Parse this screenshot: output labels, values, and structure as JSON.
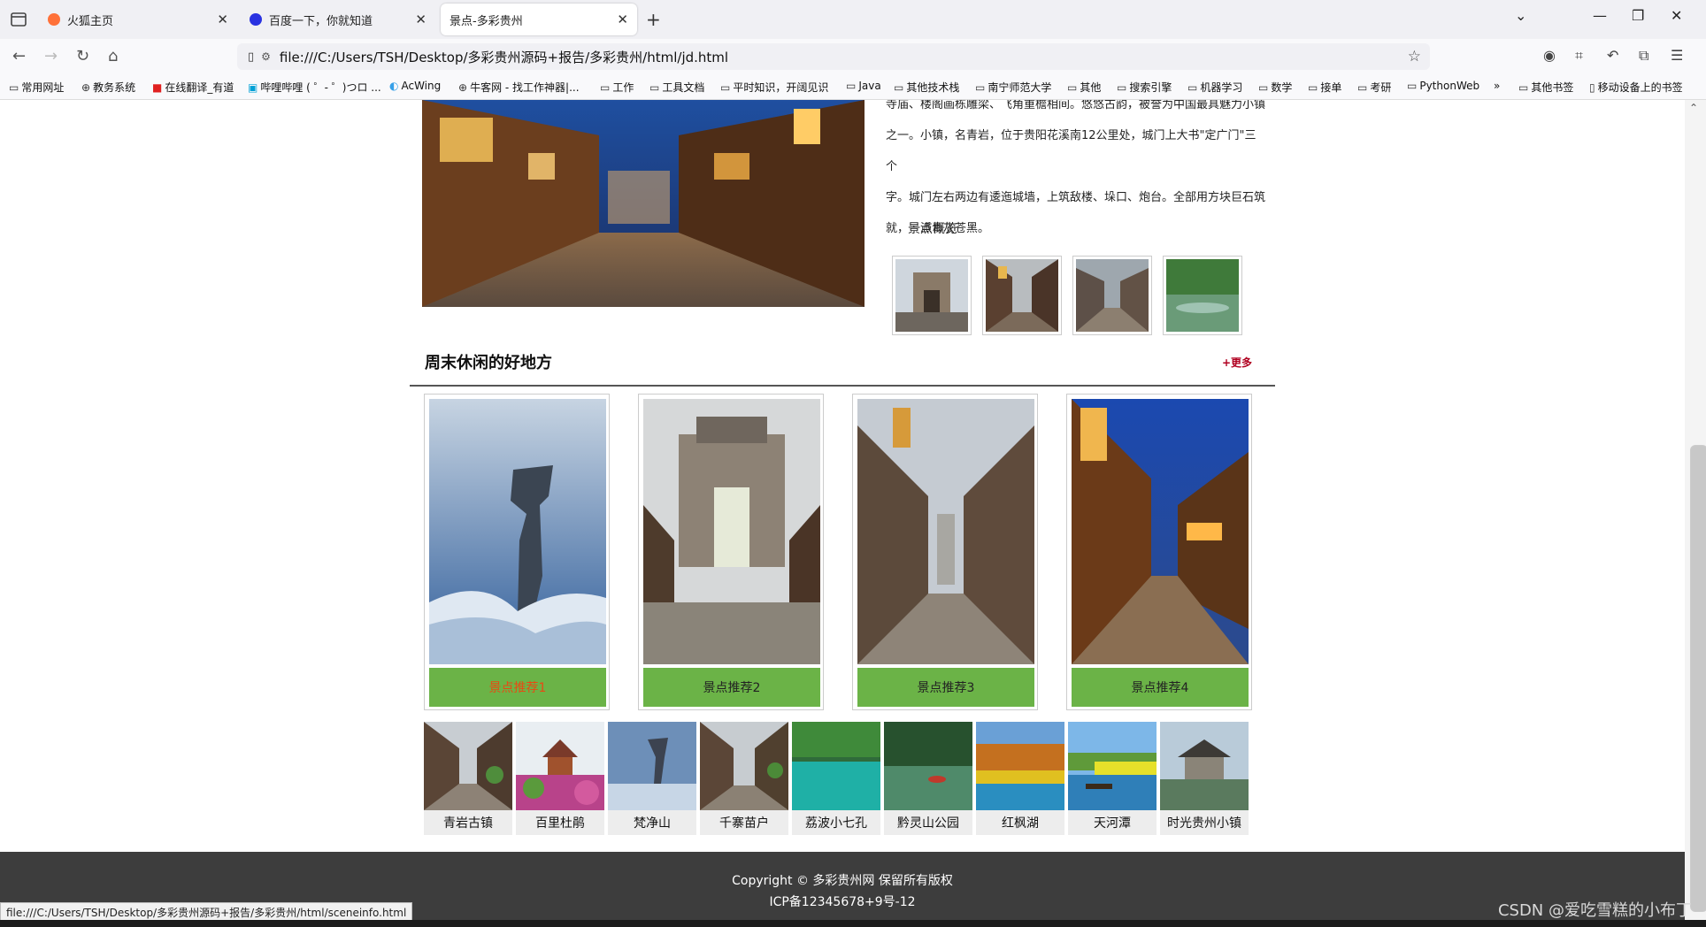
{
  "browser": {
    "tabs": [
      {
        "title": "火狐主页",
        "color": "#ff7139"
      },
      {
        "title": "百度一下，你就知道",
        "color": "#2932e1"
      },
      {
        "title": "景点-多彩贵州",
        "color": ""
      }
    ],
    "url": "file:///C:/Users/TSH/Desktop/多彩贵州源码+报告/多彩贵州/html/jd.html",
    "bookmarks": [
      "常用网址",
      "教务系统",
      "在线翻译_有道",
      "哔哩哔哩 ( ゜- ゜)つロ ...",
      "AcWing",
      "牛客网 - 找工作神器|...",
      "工作",
      "工具文档",
      "平时知识，开阔见识",
      "Java",
      "其他技术栈",
      "南宁师范大学",
      "其他",
      "搜索引擎",
      "机器学习",
      "数学",
      "接单",
      "考研",
      "PythonWeb",
      "其他书签",
      "移动设备上的书签"
    ]
  },
  "page": {
    "intro_lines": [
      "寺庙、楼阁画栋雕梁、飞角重檐相间。悠悠古韵，被誉为中国最具魅力小镇",
      "之一。小镇，名青岩，位于贵阳花溪南12公里处，城门上大书\"定广门\"三个",
      "字。城门左右两边有逶迤城墙，上筑敌楼、垛口、炮台。全部用方块巨石筑",
      "就，一派青灰苍黑。"
    ],
    "overview_title": "景点概览",
    "section_title": "周末休闲的好地方",
    "more_label": "+更多",
    "cards": [
      "景点推荐1",
      "景点推荐2",
      "景点推荐3",
      "景点推荐4"
    ],
    "minis": [
      "青岩古镇",
      "百里杜鹃",
      "梵净山",
      "千寨苗户",
      "荔波小七孔",
      "黔灵山公园",
      "红枫湖",
      "天河潭",
      "时光贵州小镇"
    ],
    "footer_copy": "Copyright © 多彩贵州网 保留所有版权",
    "footer_icp": "ICP备12345678+9号-12",
    "status_url": "file:///C:/Users/TSH/Desktop/多彩贵州源码+报告/多彩贵州/html/sceneinfo.html",
    "watermark": "CSDN @爱吃雪糕的小布丁"
  },
  "colors": {
    "card_button": "#6bb347",
    "more_link": "#b00020",
    "footer_bg": "#3d3d3d",
    "hover_text": "#e84a13"
  }
}
